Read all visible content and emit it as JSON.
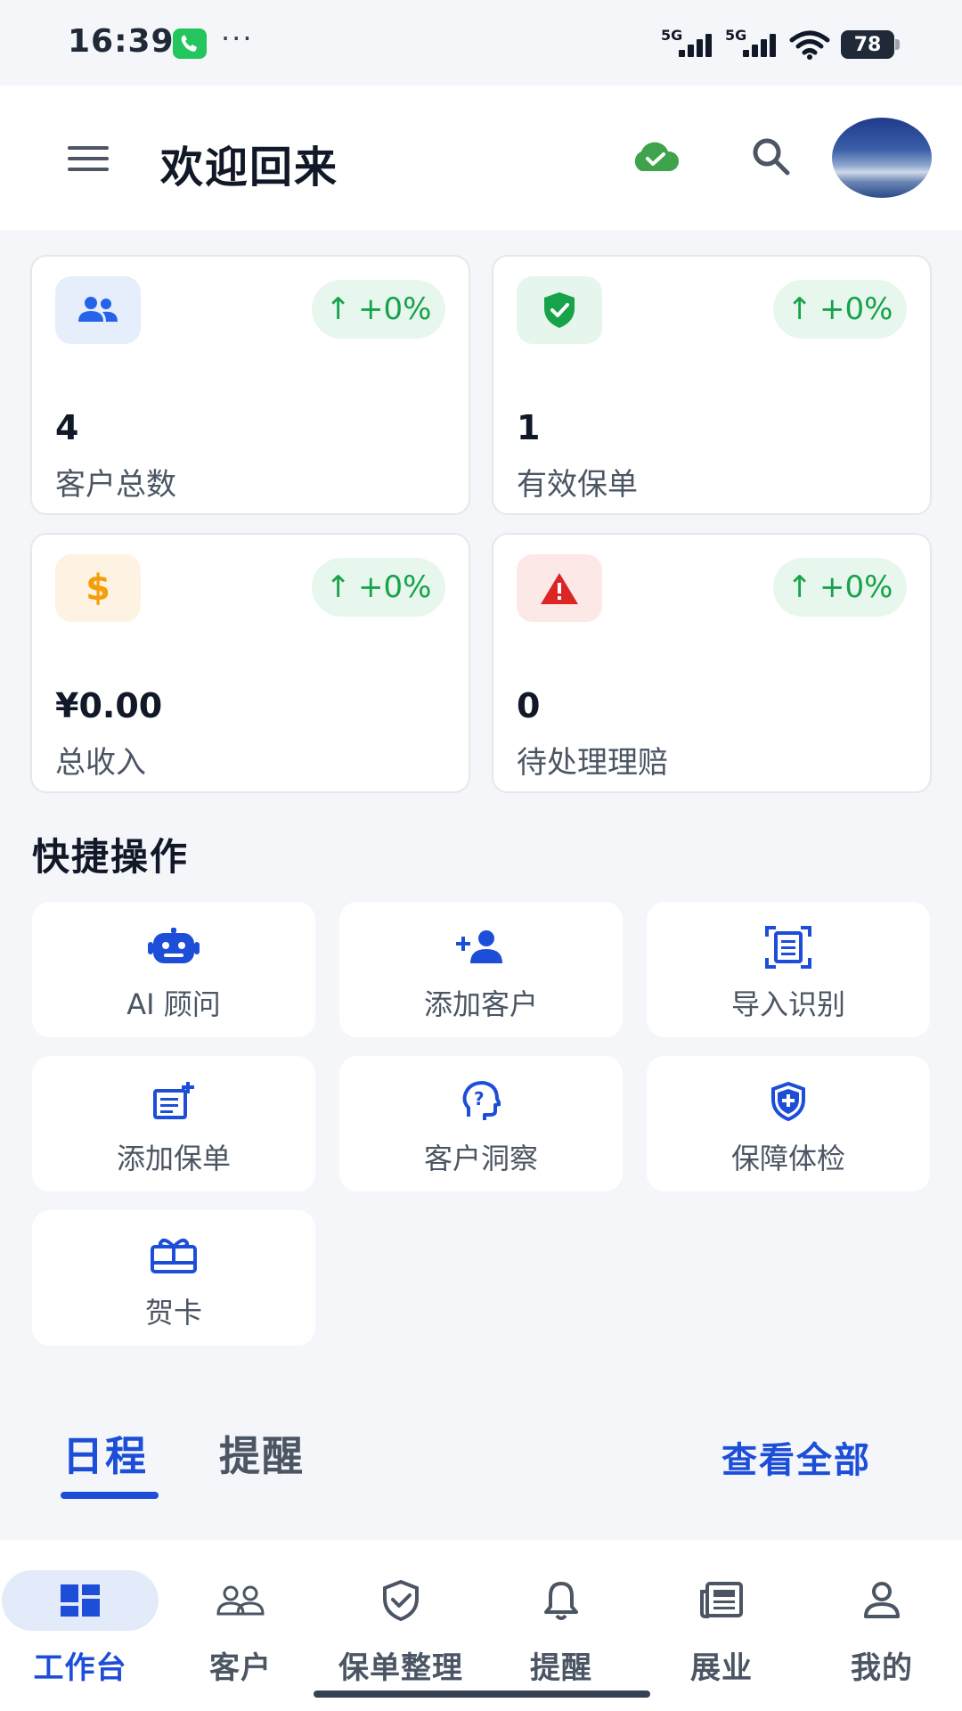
{
  "status_bar": {
    "time": "16:39",
    "dots": "···",
    "signal_1": "5G",
    "signal_2": "5G",
    "battery": "78"
  },
  "header": {
    "title": "欢迎回来"
  },
  "stats": [
    {
      "value": "4",
      "label": "客户总数",
      "change": "+0%",
      "icon": "users-icon",
      "icon_color": "#2563eb",
      "icon_bg": "#e6eefc"
    },
    {
      "value": "1",
      "label": "有效保单",
      "change": "+0%",
      "icon": "shield-check-icon",
      "icon_color": "#16a34a",
      "icon_bg": "#e7f6ec"
    },
    {
      "value": "¥0.00",
      "label": "总收入",
      "change": "+0%",
      "icon": "dollar-icon",
      "icon_color": "#f59e0b",
      "icon_bg": "#fef3e2"
    },
    {
      "value": "0",
      "label": "待处理理赔",
      "change": "+0%",
      "icon": "warning-icon",
      "icon_color": "#dc2626",
      "icon_bg": "#fde8e8"
    }
  ],
  "quick_actions": {
    "title": "快捷操作",
    "items": [
      {
        "label": "AI 顾问",
        "icon": "robot-icon"
      },
      {
        "label": "添加客户",
        "icon": "add-person-icon"
      },
      {
        "label": "导入识别",
        "icon": "scan-document-icon"
      },
      {
        "label": "添加保单",
        "icon": "add-document-icon"
      },
      {
        "label": "客户洞察",
        "icon": "insight-head-icon"
      },
      {
        "label": "保障体检",
        "icon": "shield-plus-icon"
      },
      {
        "label": "贺卡",
        "icon": "gift-card-icon"
      }
    ]
  },
  "tabs": {
    "items": [
      {
        "label": "日程",
        "active": true
      },
      {
        "label": "提醒",
        "active": false
      }
    ],
    "view_all": "查看全部"
  },
  "bottom_nav": [
    {
      "label": "工作台",
      "icon": "dashboard-icon",
      "active": true
    },
    {
      "label": "客户",
      "icon": "people-icon",
      "active": false
    },
    {
      "label": "保单整理",
      "icon": "shield-icon",
      "active": false
    },
    {
      "label": "提醒",
      "icon": "bell-icon",
      "active": false
    },
    {
      "label": "展业",
      "icon": "newspaper-icon",
      "active": false
    },
    {
      "label": "我的",
      "icon": "person-icon",
      "active": false
    }
  ],
  "colors": {
    "accent": "#1d4ed8",
    "positive": "#16a34a",
    "background": "#f4f6fa"
  }
}
